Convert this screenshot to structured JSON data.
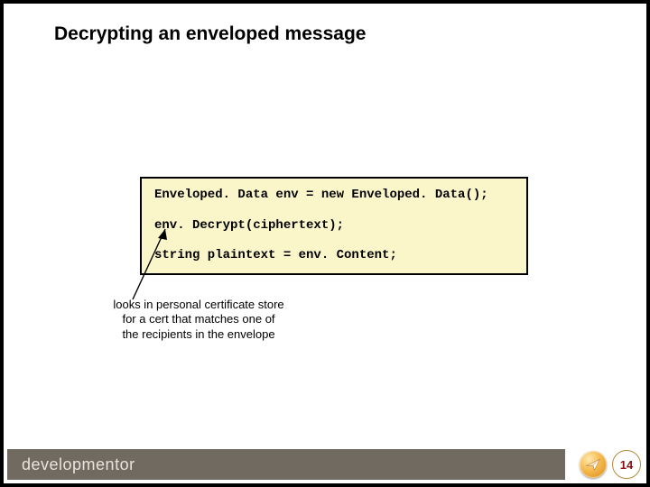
{
  "title": "Decrypting an enveloped message",
  "code": {
    "line1": "Enveloped. Data env = new Enveloped. Data();",
    "line2": "env. Decrypt(ciphertext);",
    "line3": "string plaintext = env. Content;"
  },
  "annotation": {
    "l1": "looks in personal certificate store",
    "l2": "for a cert that matches one of",
    "l3": "the recipients in the envelope"
  },
  "footer": {
    "brand": "developmentor",
    "page": "14"
  }
}
